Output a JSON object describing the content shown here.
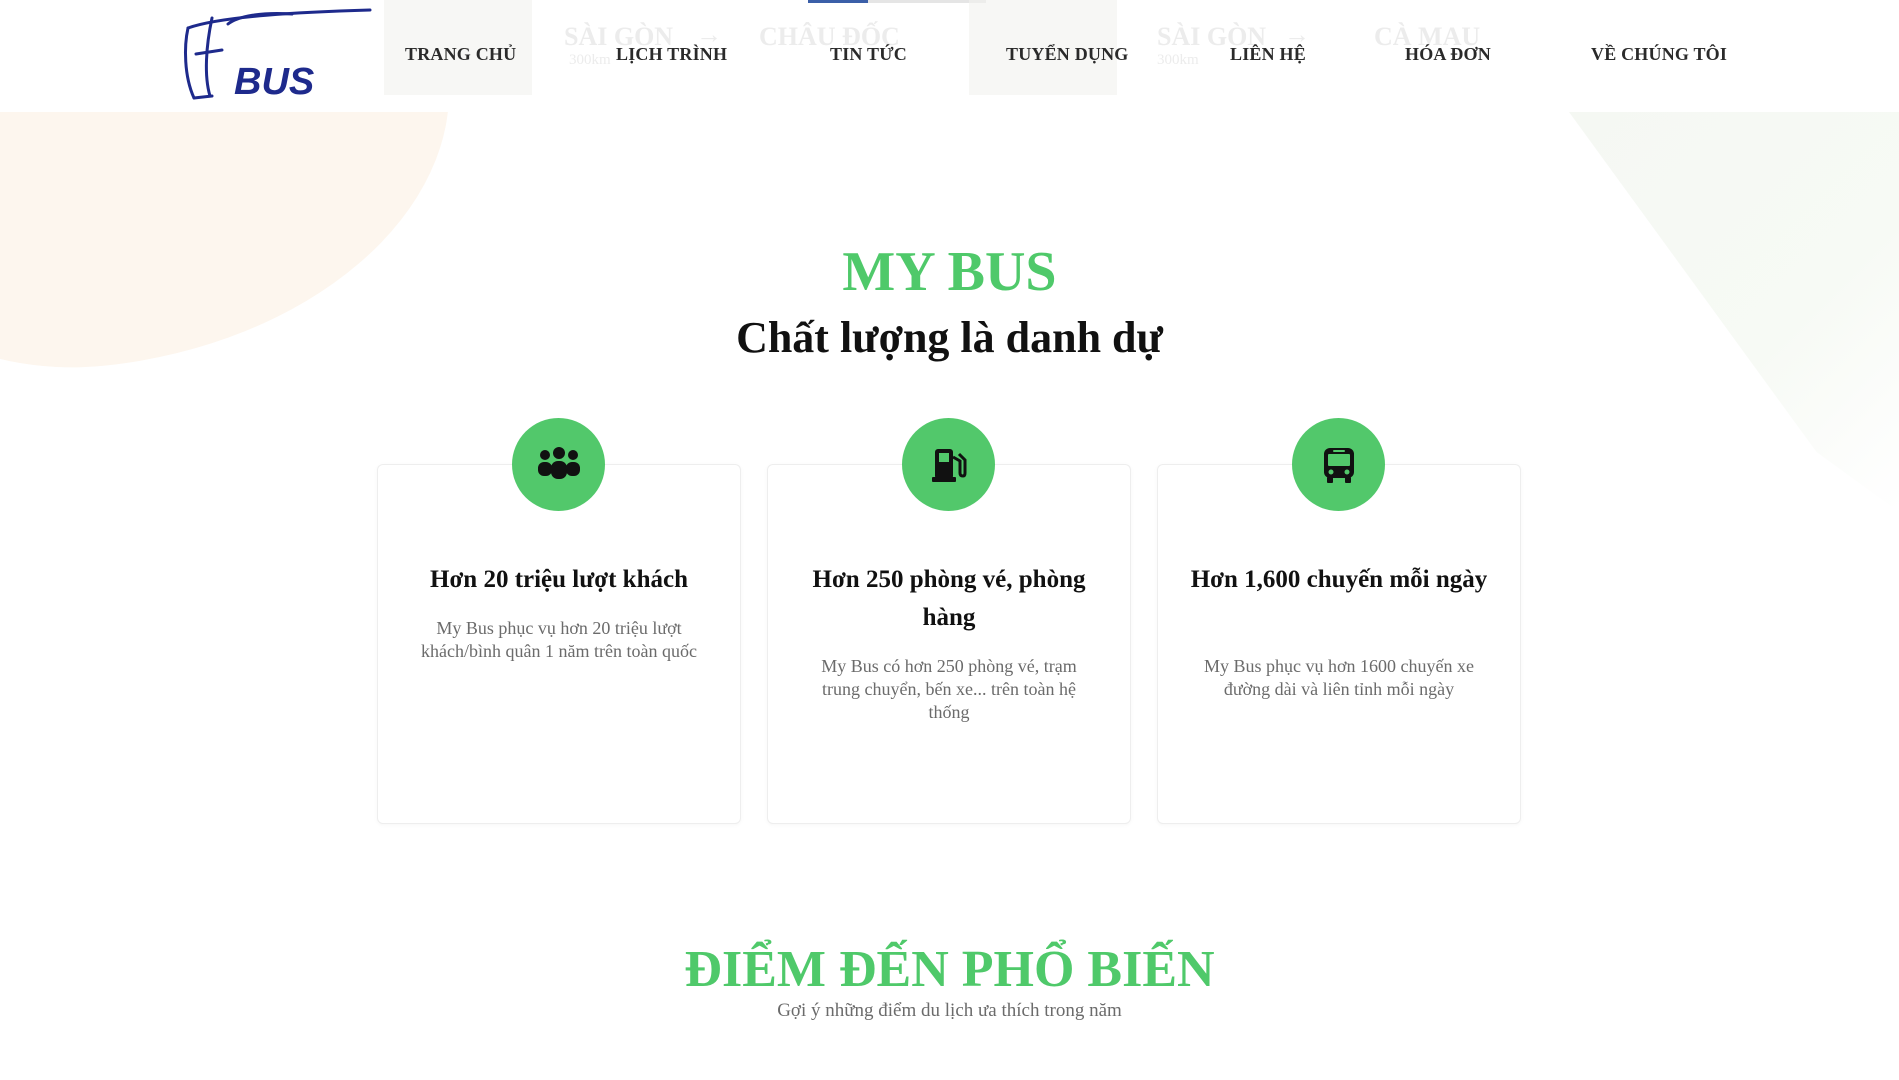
{
  "brand": {
    "logo_text": "BUS",
    "accent": "#1e2a8c",
    "green": "#52c86b"
  },
  "nav": {
    "items": [
      {
        "label": "TRANG CHỦ"
      },
      {
        "label": "LỊCH TRÌNH"
      },
      {
        "label": "TIN TỨC"
      },
      {
        "label": "TUYỂN DỤNG"
      },
      {
        "label": "LIÊN HỆ"
      },
      {
        "label": "HÓA ĐƠN"
      },
      {
        "label": "VỀ CHÚNG TÔI"
      }
    ]
  },
  "background_routes": [
    {
      "from": "SÀI GÒN",
      "to": "CHÂU ĐỐC",
      "distance": "300km"
    },
    {
      "from": "SÀI GÒN",
      "to": "CÀ MAU",
      "distance": "300km"
    }
  ],
  "hero": {
    "title": "MY BUS",
    "subtitle": "Chất lượng là danh dự"
  },
  "features": [
    {
      "icon": "people-group-icon",
      "title": "Hơn 20 triệu lượt khách",
      "description": "My Bus phục vụ hơn 20 triệu lượt khách/bình quân 1 năm trên toàn quốc"
    },
    {
      "icon": "gas-pump-icon",
      "title": "Hơn 250 phòng vé, phòng hàng",
      "description": "My Bus có hơn 250 phòng vé, trạm trung chuyển, bến xe... trên toàn hệ thống"
    },
    {
      "icon": "bus-icon",
      "title": "Hơn 1,600 chuyến mỗi ngày",
      "description": "My Bus phục vụ hơn 1600 chuyến xe đường dài và liên tỉnh mỗi ngày"
    }
  ],
  "destinations": {
    "title": "ĐIỂM ĐẾN PHỔ BIẾN",
    "subtitle": "Gợi ý những điểm du lịch ưa thích trong năm"
  }
}
